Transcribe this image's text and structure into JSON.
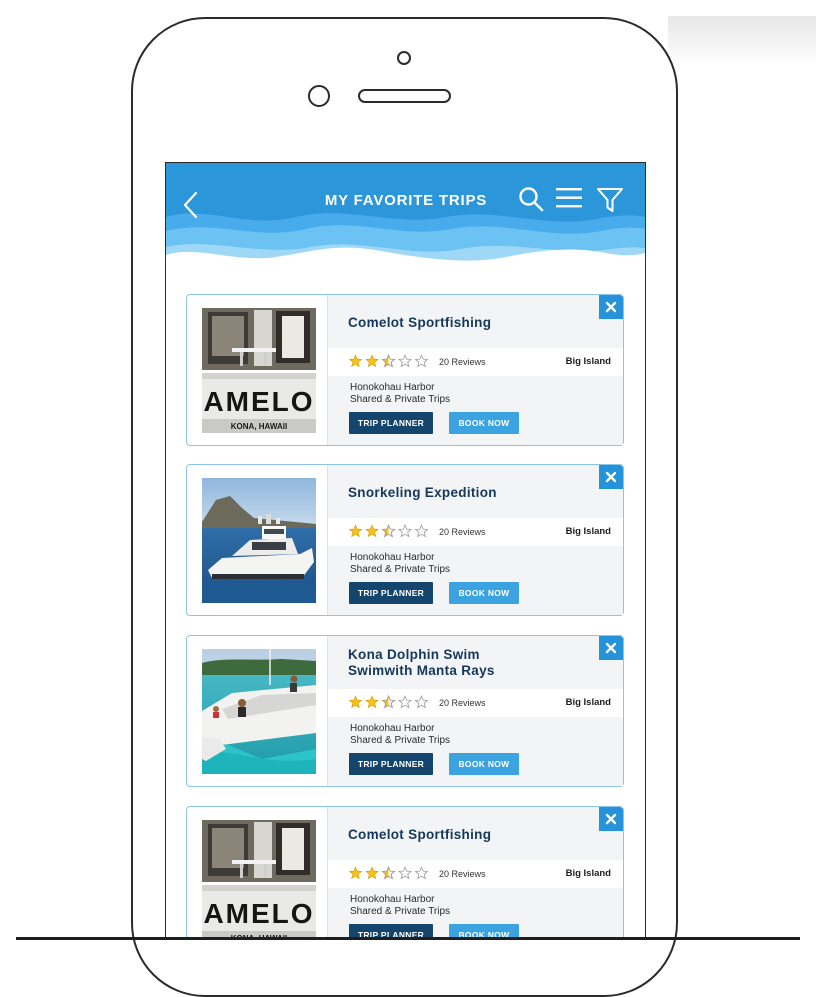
{
  "header": {
    "title": "MY FAVORITE TRIPS"
  },
  "colors": {
    "header_blue": "#2b96da",
    "planner_button": "#14466d",
    "book_button": "#3ba3e0",
    "close_button": "#2493d9",
    "star_yellow": "#f6c21a"
  },
  "icons": [
    "back-arrow-icon",
    "search-icon",
    "hamburger-menu-icon",
    "filter-icon",
    "close-icon",
    "star-icon"
  ],
  "trips": [
    {
      "title": "Comelot Sportfishing",
      "rating": 2.5,
      "reviews": "20 Reviews",
      "region": "Big Island",
      "location": "Honokohau Harbor",
      "trip_type": "Shared & Private Trips",
      "planner_label": "TRIP PLANNER",
      "book_label": "BOOK NOW",
      "photo": "boat-stern",
      "photo_text": "AMELO",
      "photo_subtext": "KONA, HAWAII"
    },
    {
      "title": "Snorkeling  Expedition",
      "rating": 2.5,
      "reviews": "20 Reviews",
      "region": "Big Island",
      "location": "Honokohau Harbor",
      "trip_type": "Shared & Private Trips",
      "planner_label": "TRIP PLANNER",
      "book_label": "BOOK NOW",
      "photo": "yacht-diamond-head"
    },
    {
      "title": "Kona Dolphin Swim\nSwimwith Manta Rays",
      "rating": 2.5,
      "reviews": "20 Reviews",
      "region": "Big Island",
      "location": "Honokohau Harbor",
      "trip_type": "Shared & Private Trips",
      "planner_label": "TRIP PLANNER",
      "book_label": "BOOK NOW",
      "photo": "catamaran-turquoise"
    },
    {
      "title": "Comelot Sportfishing",
      "rating": 2.5,
      "reviews": "20 Reviews",
      "region": "Big Island",
      "location": "Honokohau Harbor",
      "trip_type": "Shared & Private Trips",
      "planner_label": "TRIP PLANNER",
      "book_label": "BOOK NOW",
      "photo": "boat-stern",
      "photo_text": "AMELO",
      "photo_subtext": "KONA, HAWAII"
    }
  ]
}
